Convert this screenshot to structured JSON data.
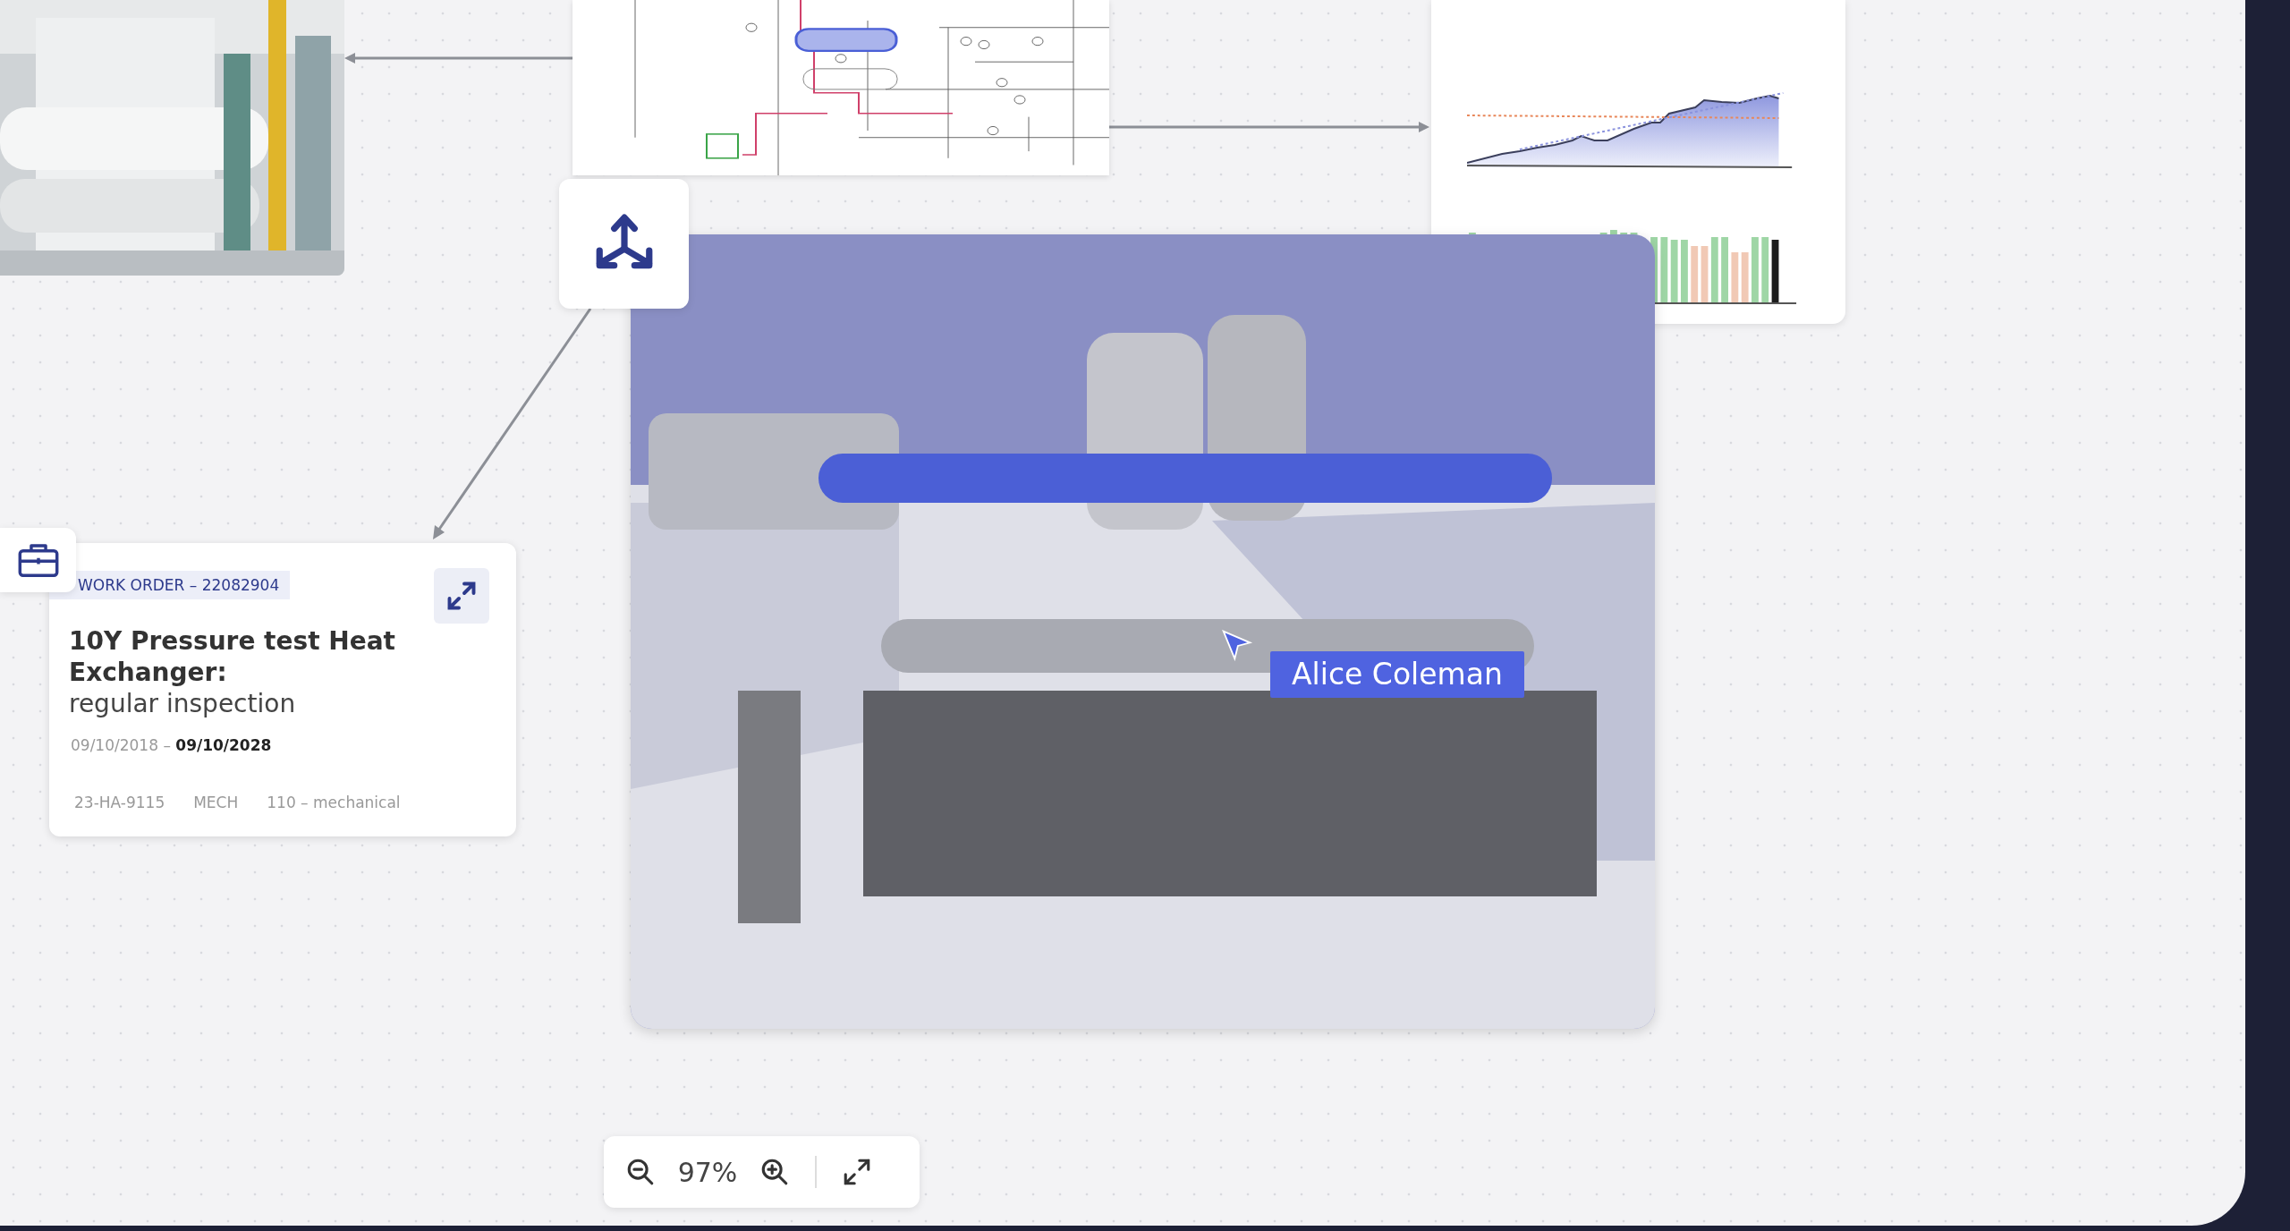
{
  "work_order": {
    "tag": "WORK ORDER – 22082904",
    "title": "10Y Pressure test Heat Exchanger:",
    "subtitle": "regular inspection",
    "dates": "09/10/2018 – **09/10/2028**",
    "meta": [
      "23-HA-9115",
      "MECH",
      "110 – mechanical"
    ]
  },
  "cursor": {
    "label": "Alice Coleman"
  },
  "zoom": {
    "value": "97%"
  }
}
